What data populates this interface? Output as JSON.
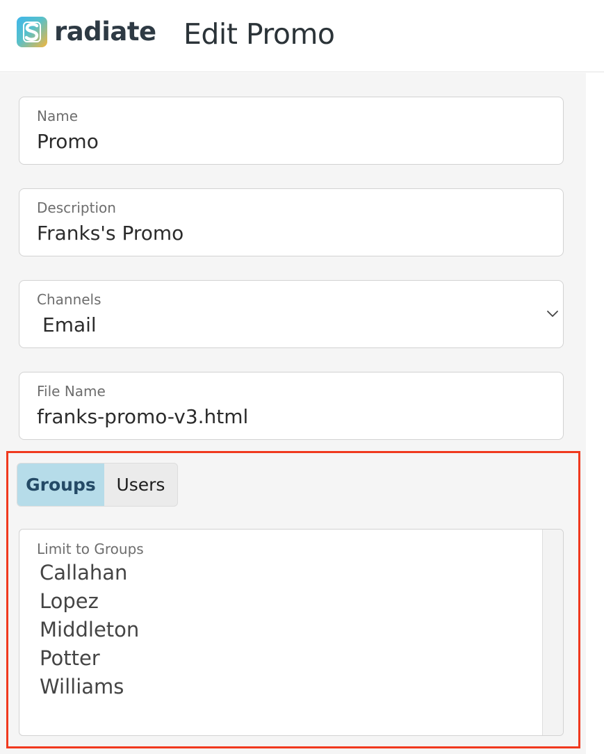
{
  "header": {
    "brand": "radiate",
    "title": "Edit Promo",
    "logo_icon": "s-logo-icon"
  },
  "form": {
    "name": {
      "label": "Name",
      "value": "Promo"
    },
    "description": {
      "label": "Description",
      "value": "Franks's Promo"
    },
    "channels": {
      "label": "Channels",
      "value": "Email",
      "icon": "chevron-down-icon"
    },
    "file_name": {
      "label": "File Name",
      "value": "franks-promo-v3.html"
    }
  },
  "tabs": [
    {
      "label": "Groups",
      "active": true
    },
    {
      "label": "Users",
      "active": false
    }
  ],
  "groups_list": {
    "label": "Limit to Groups",
    "options": [
      "Callahan",
      "Lopez",
      "Middleton",
      "Potter",
      "Williams"
    ]
  },
  "colors": {
    "highlight": "#f0391e",
    "active_tab_bg": "#b6dce9",
    "active_tab_text": "#244a66"
  }
}
